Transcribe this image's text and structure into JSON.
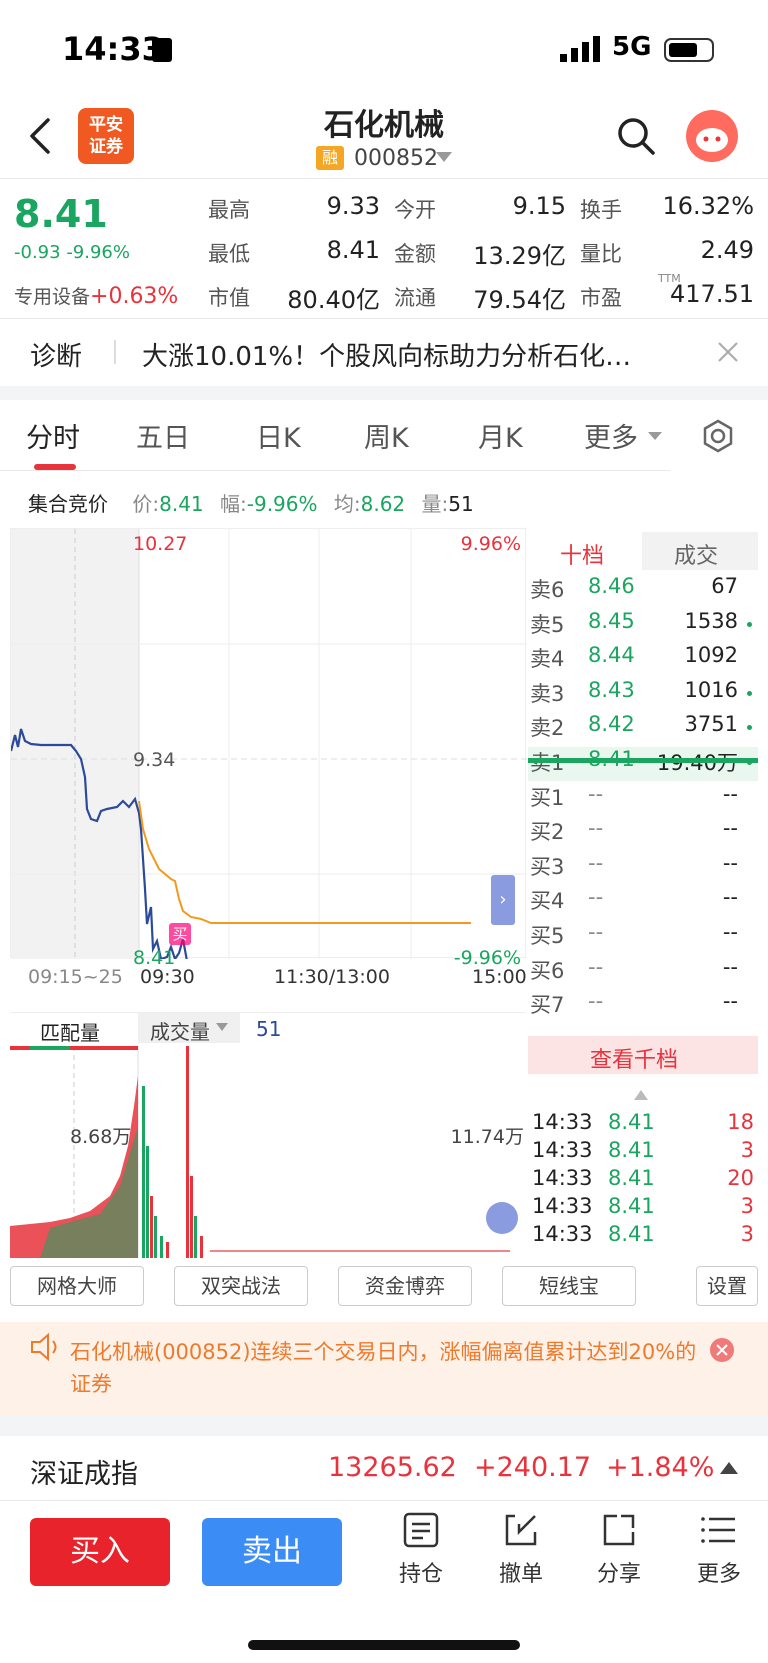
{
  "status_bar": {
    "time": "14:33",
    "network": "5G"
  },
  "header": {
    "logo_text": "平安证券",
    "title": "石化机械",
    "margin_tag": "融",
    "code": "000852"
  },
  "quote": {
    "price": "8.41",
    "change": "-0.93",
    "change_pct": "-9.96%",
    "sector_name": "专用设备",
    "sector_pct": "+0.63%",
    "fields": [
      {
        "label": "最高",
        "value": "9.33"
      },
      {
        "label": "今开",
        "value": "9.15"
      },
      {
        "label": "换手",
        "value": "16.32%"
      },
      {
        "label": "最低",
        "value": "8.41"
      },
      {
        "label": "金额",
        "value": "13.29亿"
      },
      {
        "label": "量比",
        "value": "2.49"
      },
      {
        "label": "市值",
        "value": "80.40亿"
      },
      {
        "label": "流通",
        "value": "79.54亿"
      },
      {
        "label": "市盈",
        "value": "417.51"
      }
    ],
    "ttm_tag": "TTM"
  },
  "diagnosis": {
    "label": "诊断",
    "text": "大涨10.01%！个股风向标助力分析石化…"
  },
  "tabs": [
    "分时",
    "五日",
    "日K",
    "周K",
    "月K",
    "更多"
  ],
  "auction": {
    "title": "集合竞价",
    "price_label": "价:",
    "price": "8.41",
    "amp_label": "幅:",
    "amp": "-9.96%",
    "avg_label": "均:",
    "avg": "8.62",
    "vol_label": "量:",
    "vol": "51"
  },
  "chart": {
    "top_price": "10.27",
    "top_pct": "9.96%",
    "mid_price": "9.34",
    "low_price": "8.41",
    "low_pct": "-9.96%",
    "x_labels": [
      "09:15~25",
      "09:30",
      "11:30/13:00",
      "15:00"
    ],
    "buy_marker": "买",
    "match_label": "匹配量",
    "vol_tab": "成交量",
    "vol_value": "51",
    "vol_left": "8.68万",
    "vol_right": "11.74万"
  },
  "order_book": {
    "tabs": [
      "十档",
      "成交"
    ],
    "rows": [
      {
        "label": "卖6",
        "price": "8.46",
        "vol": "67"
      },
      {
        "label": "卖5",
        "price": "8.45",
        "vol": "1538"
      },
      {
        "label": "卖4",
        "price": "8.44",
        "vol": "1092"
      },
      {
        "label": "卖3",
        "price": "8.43",
        "vol": "1016"
      },
      {
        "label": "卖2",
        "price": "8.42",
        "vol": "3751"
      },
      {
        "label": "卖1",
        "price": "8.41",
        "vol": "19.40万"
      },
      {
        "label": "买1",
        "price": "--",
        "vol": "--"
      },
      {
        "label": "买2",
        "price": "--",
        "vol": "--"
      },
      {
        "label": "买3",
        "price": "--",
        "vol": "--"
      },
      {
        "label": "买4",
        "price": "--",
        "vol": "--"
      },
      {
        "label": "买5",
        "price": "--",
        "vol": "--"
      },
      {
        "label": "买6",
        "price": "--",
        "vol": "--"
      },
      {
        "label": "买7",
        "price": "--",
        "vol": "--"
      }
    ],
    "view_more": "查看千档",
    "ticks": [
      {
        "time": "14:33",
        "price": "8.41",
        "vol": "18"
      },
      {
        "time": "14:33",
        "price": "8.41",
        "vol": "3"
      },
      {
        "time": "14:33",
        "price": "8.41",
        "vol": "20"
      },
      {
        "time": "14:33",
        "price": "8.41",
        "vol": "3"
      },
      {
        "time": "14:33",
        "price": "8.41",
        "vol": "3"
      }
    ]
  },
  "tools": [
    "网格大师",
    "双突战法",
    "资金博弈",
    "短线宝",
    "设置"
  ],
  "notice": "石化机械(000852)连续三个交易日内，涨幅偏离值累计达到20%的证券",
  "index": {
    "name": "深证成指",
    "value": "13265.62",
    "change": "+240.17",
    "pct": "+1.84%"
  },
  "bottom": {
    "buy": "买入",
    "sell": "卖出",
    "items": [
      "持仓",
      "撤单",
      "分享",
      "更多"
    ]
  },
  "colors": {
    "up": "#e8333c",
    "down": "#1aa560",
    "price_line": "#2b4a9a",
    "avg_line": "#f39a1e"
  }
}
